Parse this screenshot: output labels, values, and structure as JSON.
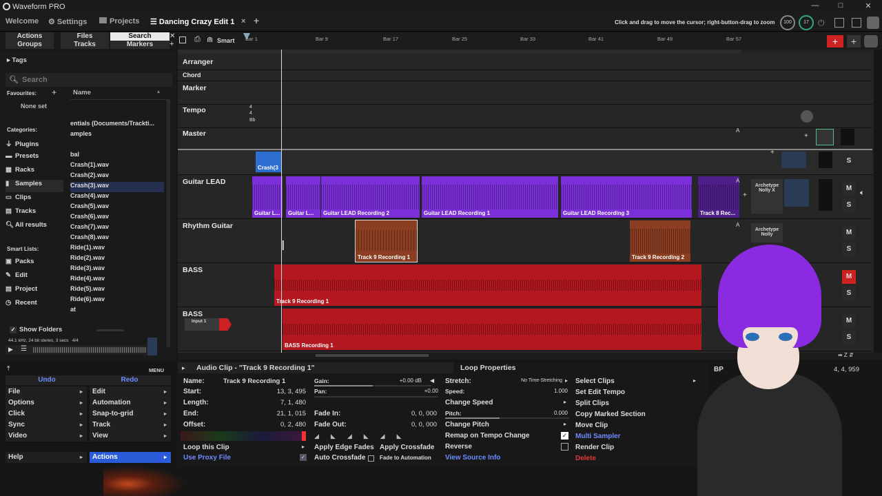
{
  "app": {
    "title": "Waveform PRO"
  },
  "window_controls": [
    "—",
    "□",
    "✕"
  ],
  "tabs": {
    "welcome": "Welcome",
    "settings": "Settings",
    "projects": "Projects",
    "edit": "Dancing Crazy Edit 1",
    "close": "×",
    "add": "+"
  },
  "hint": "Click and drag to move the cursor; right-button-drag to zoom",
  "meters": {
    "cpu": "100",
    "cpu2": "17"
  },
  "browser_tabs": {
    "actions": "Actions",
    "files": "Files",
    "search": "Search",
    "groups": "Groups",
    "tracks": "Tracks",
    "markers": "Markers"
  },
  "browser": {
    "tags": "Tags",
    "search_placeholder": "Search",
    "favourites": "Favourites:",
    "none_set": "None set",
    "name_col": "Name",
    "categories": "Categories:",
    "cats": [
      "Plugins",
      "Presets",
      "Racks",
      "Samples",
      "Clips",
      "Tracks",
      "All results"
    ],
    "smart_lists": "Smart Lists:",
    "smart": [
      "Packs",
      "Edit",
      "Project",
      "Recent"
    ],
    "files": [
      "entials (Documents/Trackti...",
      "amples",
      "bal",
      "Crash(1).wav",
      "Crash(2).wav",
      "Crash(3).wav",
      "Crash(4).wav",
      "Crash(5).wav",
      "Crash(6).wav",
      "Crash(7).wav",
      "Crash(8).wav",
      "Ride(1).wav",
      "Ride(2).wav",
      "Ride(3).wav",
      "Ride(4).wav",
      "Ride(5).wav",
      "Ride(6).wav",
      "at"
    ],
    "show_folders": "Show Folders",
    "format": "44.1 kHz, 24 bit stereo, 3 secs",
    "format_count": "4/4"
  },
  "toolbar": {
    "smart": "Smart"
  },
  "ruler": [
    "Bar 1",
    "Bar 9",
    "Bar 17",
    "Bar 25",
    "Bar 33",
    "Bar 41",
    "Bar 49",
    "Bar 57"
  ],
  "tracks": {
    "arranger": "Arranger",
    "chord": "Chord",
    "marker": "Marker",
    "tempo": "Tempo",
    "tempo_marks": [
      "4",
      "4",
      "Bb"
    ],
    "master": "Master",
    "t1": {
      "clip": "Crash(3"
    },
    "t2": {
      "name": "Guitar LEAD",
      "clips": [
        "Guitar L...",
        "Guitar L...",
        "Guitar LEAD Recording 2",
        "Guitar LEAD Recording 1",
        "Guitar LEAD Recording 3",
        "Track 8 Rec..."
      ],
      "plugin": "Archetype Nolly X"
    },
    "t3": {
      "name": "Rhythm Guitar",
      "clips": [
        "Track 9 Recording 1",
        "Track 9 Recording 2"
      ],
      "plugin": "Archetype Nolly"
    },
    "t4": {
      "name": "BASS",
      "clip": "Track 9 Recording 1"
    },
    "t5": {
      "name": "BASS",
      "input": "Input 1",
      "clip": "BASS Recording 1"
    },
    "auto": "A",
    "m": "M",
    "s": "S"
  },
  "actions_panel": {
    "menu": "MENU",
    "undo": "Undo",
    "redo": "Redo",
    "left": [
      "File",
      "Options",
      "Click",
      "Sync",
      "Video"
    ],
    "right": [
      "Edit",
      "Automation",
      "Snap-to-grid",
      "Track",
      "View"
    ],
    "help": "Help",
    "actions": "Actions"
  },
  "clip_props": {
    "title": "Audio Clip - \"Track 9 Recording 1\"",
    "name_label": "Name:",
    "name": "Track 9 Recording 1",
    "start_label": "Start:",
    "start": "13, 3, 495",
    "length_label": "Length:",
    "length": "7, 1, 480",
    "end_label": "End:",
    "end": "21, 1, 015",
    "offset_label": "Offset:",
    "offset": "0, 2, 480",
    "gain_label": "Gain:",
    "gain": "+0.00 dB",
    "pan_label": "Pan:",
    "pan": "+0.00",
    "fadein_label": "Fade In:",
    "fadein": "0, 0, 000",
    "fadeout_label": "Fade Out:",
    "fadeout": "0, 0, 000",
    "loop": "Loop this Clip",
    "proxy": "Use Proxy File",
    "edge_fades": "Apply Edge Fades",
    "crossfade": "Apply Crossfade",
    "auto_crossfade": "Auto Crossfade",
    "fade_auto": "Fade to Automation"
  },
  "loop_props": {
    "title": "Loop Properties",
    "stretch_label": "Stretch:",
    "stretch": "No Time-Stretching",
    "speed_label": "Speed:",
    "speed": "1.000",
    "change_speed": "Change Speed",
    "pitch_label": "Pitch:",
    "pitch": "0.000",
    "change_pitch": "Change Pitch",
    "remap": "Remap on Tempo Change",
    "reverse": "Reverse",
    "source": "View Source Info"
  },
  "clip_actions": [
    "Select Clips",
    "Set Edit Tempo",
    "Split Clips",
    "Copy Marked Section",
    "Move Clip",
    "Multi Sampler",
    "Render Clip",
    "Delete"
  ],
  "transport": {
    "bpm": "BP",
    "pos": "4, 4, 959"
  }
}
